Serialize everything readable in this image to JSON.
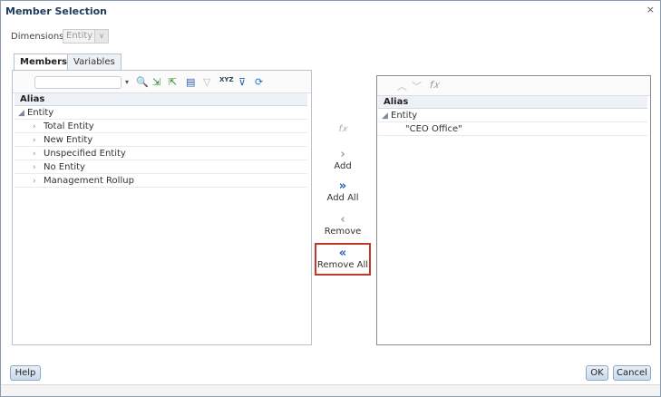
{
  "dialog": {
    "title": "Member Selection",
    "close": "×"
  },
  "dimensions": {
    "label": "Dimensions",
    "value": "Entity"
  },
  "tabs": [
    {
      "label": "Members"
    },
    {
      "label": "Variables"
    }
  ],
  "left": {
    "header": "Alias",
    "root": "Entity",
    "items": [
      "Total Entity",
      "New Entity",
      "Unspecified Entity",
      "No Entity",
      "Management Rollup"
    ]
  },
  "actions": {
    "add": "Add",
    "add_all": "Add All",
    "remove": "Remove",
    "remove_all": "Remove All"
  },
  "right": {
    "header": "Alias",
    "root": "Entity",
    "items": [
      "\"CEO Office\""
    ]
  },
  "buttons": {
    "help": "Help",
    "ok": "OK",
    "cancel": "Cancel"
  },
  "colors": {
    "highlight": "#c0392b",
    "accent": "#1a5fb4"
  }
}
